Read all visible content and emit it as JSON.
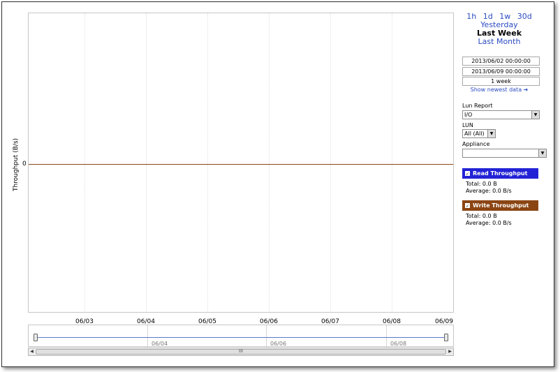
{
  "chart": {
    "ylabel": "Throughput (B/s)",
    "y_tick": "0",
    "x_ticks": [
      "06/03",
      "06/04",
      "06/05",
      "06/06",
      "06/07",
      "06/08",
      "06/09"
    ]
  },
  "navigator": {
    "labels": [
      "06/04",
      "06/06",
      "06/08"
    ],
    "scroll_grip": "III",
    "scroll_left": "◀",
    "scroll_right": "▶"
  },
  "chart_data": {
    "type": "line",
    "title": "",
    "xlabel": "",
    "ylabel": "Throughput (B/s)",
    "categories": [
      "06/03",
      "06/04",
      "06/05",
      "06/06",
      "06/07",
      "06/08",
      "06/09"
    ],
    "series": [
      {
        "name": "Read Throughput",
        "values": [
          0,
          0,
          0,
          0,
          0,
          0,
          0
        ],
        "color": "#2323d6"
      },
      {
        "name": "Write Throughput",
        "values": [
          0,
          0,
          0,
          0,
          0,
          0,
          0
        ],
        "color": "#8b4513"
      }
    ],
    "grid": true,
    "legend": "right"
  },
  "time_ranges": {
    "short": [
      "1h",
      "1d",
      "1w",
      "30d"
    ],
    "yesterday": "Yesterday",
    "last_week": "Last Week",
    "last_month": "Last Month",
    "selected": "Last Week"
  },
  "date_range": {
    "start": "2013/06/02 00:00:00",
    "end": "2013/06/09 00:00:00",
    "duration": "1 week"
  },
  "show_newest": "Show newest data ➜",
  "lun_report": {
    "label": "Lun Report",
    "value": "I/O"
  },
  "lun": {
    "label": "LUN",
    "value": "All (All)"
  },
  "appliance": {
    "label": "Appliance",
    "value": ""
  },
  "dropdown_glyph": "▼",
  "check_glyph": "✓",
  "legend": [
    {
      "name": "Read Throughput",
      "color": "#2323d6",
      "total": "Total:  0.0 B",
      "average": "Average:  0.0 B/s"
    },
    {
      "name": "Write Throughput",
      "color": "#8b4513",
      "total": "Total:  0.0 B",
      "average": "Average:  0.0 B/s"
    }
  ]
}
